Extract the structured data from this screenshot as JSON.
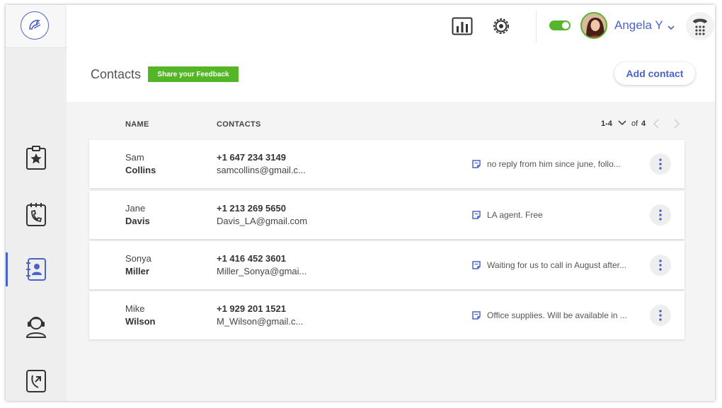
{
  "user": {
    "name": "Angela Y"
  },
  "page": {
    "title": "Contacts",
    "feedback_label": "Share your Feedback",
    "add_contact_label": "Add contact"
  },
  "table": {
    "headers": {
      "name": "NAME",
      "contacts": "CONTACTS"
    },
    "pagination": {
      "range": "1-4",
      "of_label": "of",
      "total": "4"
    },
    "rows": [
      {
        "first": "Sam",
        "last": "Collins",
        "phone": "+1 647 234 3149",
        "email": "samcollins@gmail.c...",
        "note": "no reply from him since june, follo..."
      },
      {
        "first": "Jane",
        "last": "Davis",
        "phone": "+1 213 269 5650",
        "email": "Davis_LA@gmail.com",
        "note": "LA agent. Free"
      },
      {
        "first": "Sonya",
        "last": "Miller",
        "phone": "+1 416 452 3601",
        "email": "Miller_Sonya@gmai...",
        "note": "Waiting for us to call in August after..."
      },
      {
        "first": "Mike",
        "last": "Wilson",
        "phone": "+1 929 201 1521",
        "email": "M_Wilson@gmail.c...",
        "note": "Office supplies. Will be available in ..."
      }
    ]
  },
  "sidebar": {
    "items": [
      {
        "icon": "favorites-clipboard-icon",
        "active": false
      },
      {
        "icon": "calendar-phone-icon",
        "active": false
      },
      {
        "icon": "contacts-book-icon",
        "active": true
      },
      {
        "icon": "support-agent-icon",
        "active": false
      },
      {
        "icon": "transfer-call-icon",
        "active": false
      }
    ]
  },
  "colors": {
    "accent": "#4a63c9",
    "green": "#54b526"
  }
}
